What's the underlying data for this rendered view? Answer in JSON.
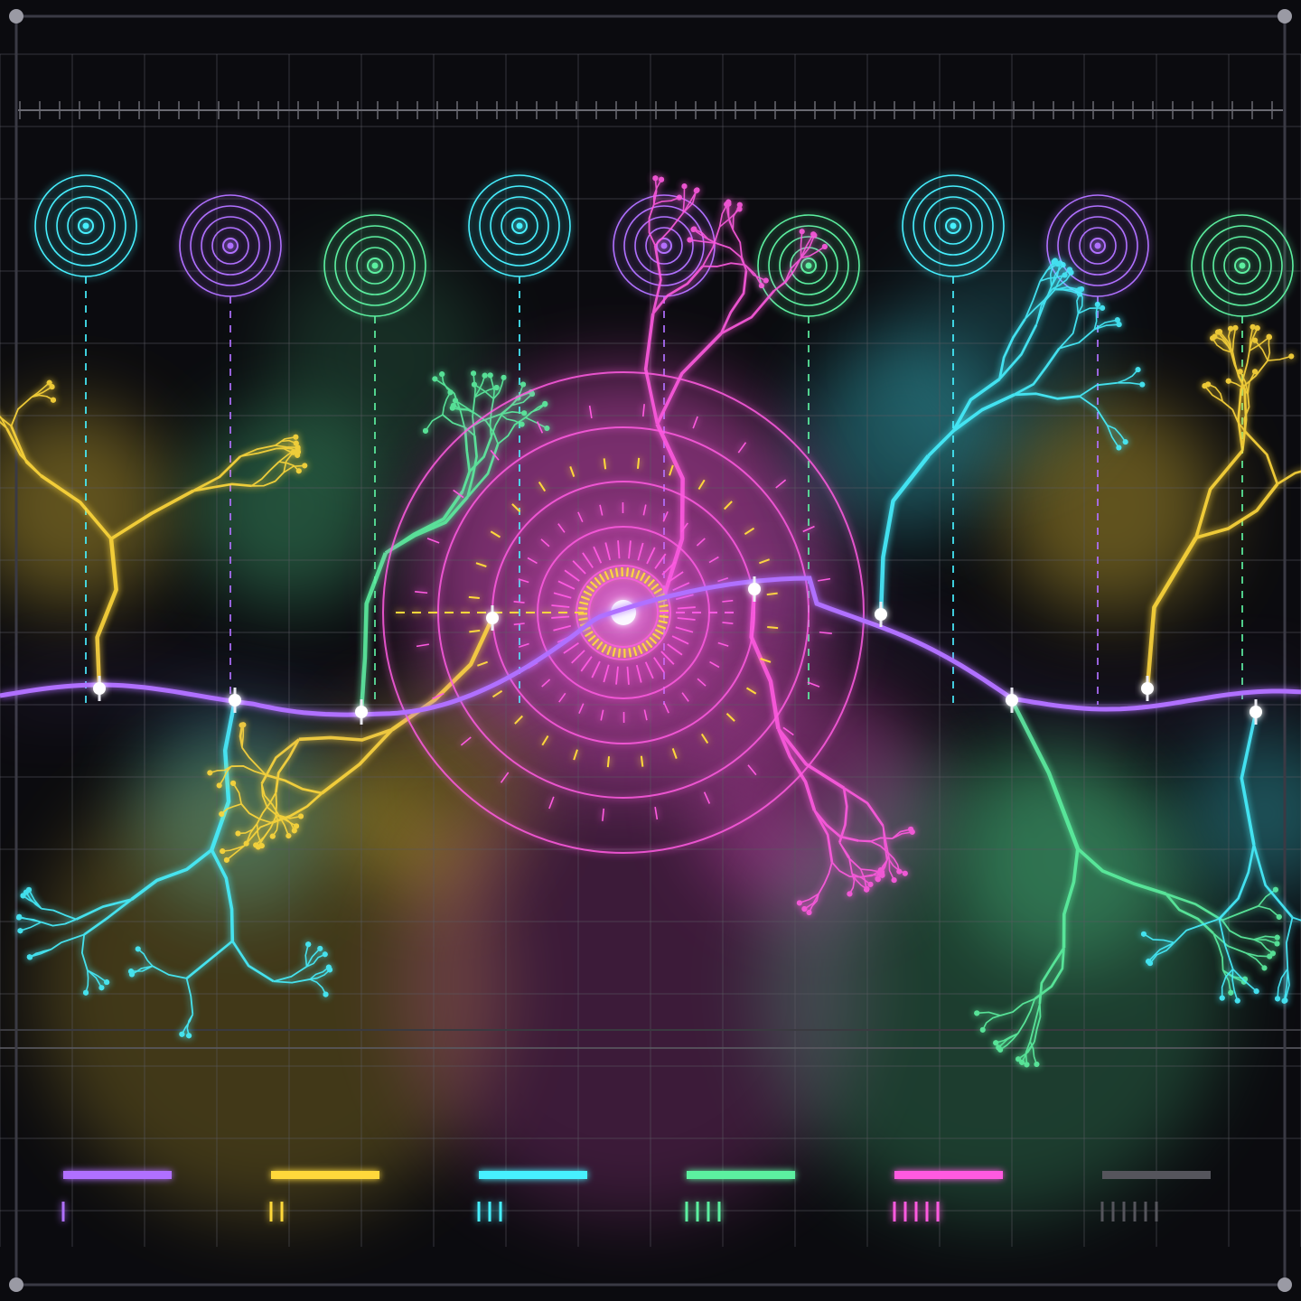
{
  "colors": {
    "background": "#0b0b0f",
    "frame": "#3a3a44",
    "grid": "#5a5a62",
    "violet": "#b070ff",
    "yellow": "#ffd83a",
    "cyan": "#46f0ff",
    "green": "#5cf0a0",
    "magenta": "#ff5ae0",
    "gray": "#55555c",
    "tick_orange": "#ffb030",
    "white": "#ffffff"
  },
  "targets": [
    {
      "color": "cyan",
      "name": "target-cyan-1"
    },
    {
      "color": "violet",
      "name": "target-violet-1"
    },
    {
      "color": "green",
      "name": "target-green-1"
    },
    {
      "color": "cyan",
      "name": "target-cyan-2"
    },
    {
      "color": "violet",
      "name": "target-violet-2"
    },
    {
      "color": "green",
      "name": "target-green-2"
    },
    {
      "color": "cyan",
      "name": "target-cyan-3"
    },
    {
      "color": "violet",
      "name": "target-violet-3"
    },
    {
      "color": "green",
      "name": "target-green-3"
    }
  ],
  "legend": [
    {
      "color": "violet",
      "count": 1
    },
    {
      "color": "yellow",
      "count": 2
    },
    {
      "color": "cyan",
      "count": 3
    },
    {
      "color": "green",
      "count": 4
    },
    {
      "color": "magenta",
      "count": 5
    },
    {
      "color": "gray",
      "count": 6
    }
  ],
  "corner_icons": [
    "corner-dot-icon",
    "corner-dot-icon",
    "corner-dot-icon",
    "corner-dot-icon"
  ]
}
